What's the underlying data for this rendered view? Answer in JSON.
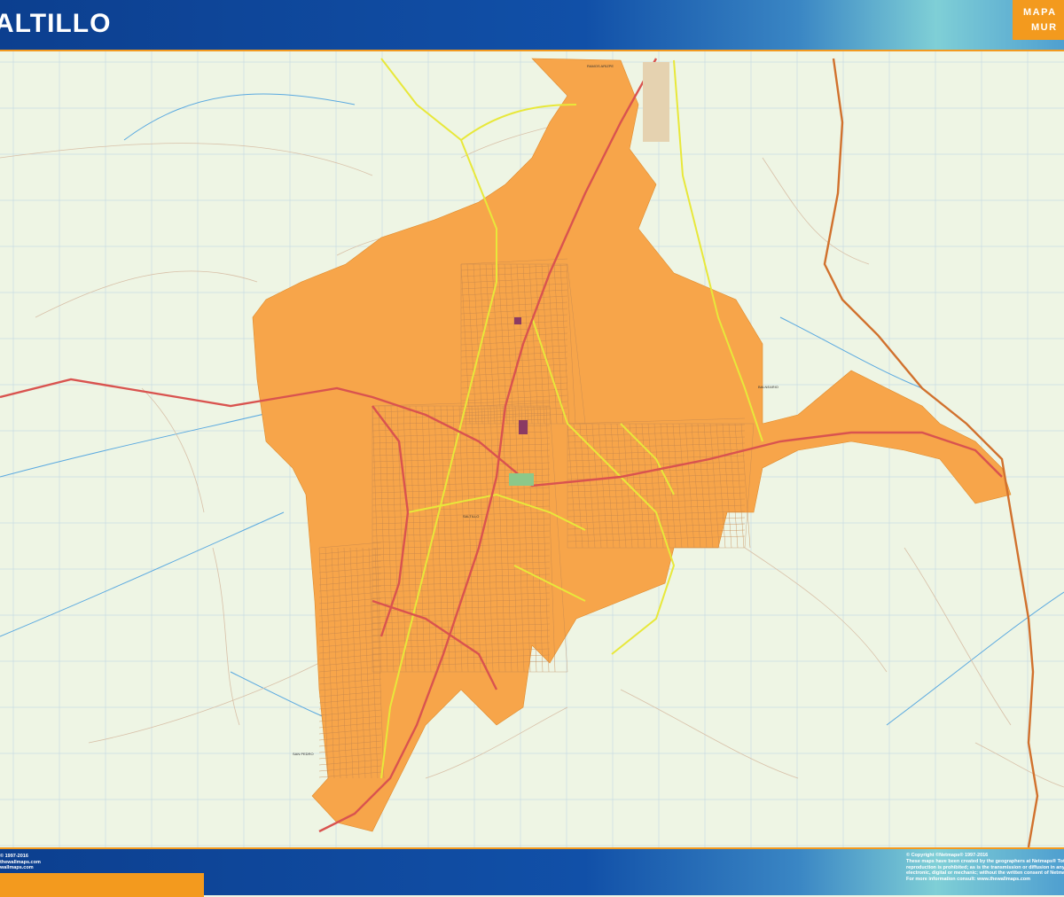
{
  "header": {
    "title": "ALTILLO"
  },
  "logo": {
    "line1": "MAPA",
    "line2": "MUR"
  },
  "map": {
    "labels": [
      "SALTILLO",
      "RAMOS ARIZPE",
      "BALNEARIO",
      "SAN PEDRO"
    ]
  },
  "footer": {
    "left": [
      "© 1997-2016",
      "thewallmaps.com",
      "wallmaps.com"
    ],
    "right": [
      "© Copyright ©Netmaps® 1997-2016",
      "These maps have been created by the geographers at Netmaps® Tota",
      "reproduction is prohibited; as is the transmission or diffusion in any",
      "electronic, digital or mechanic; without the written consent of Netma",
      "For more information consult: www.thewallmaps.com"
    ]
  },
  "colors": {
    "urban": "#f7a54a",
    "background": "#eef5e4",
    "highway": "#d9534f",
    "main_road": "#e8e83a",
    "water": "#5aa9e0",
    "accent": "#f39a1e",
    "header": "#1150a8"
  }
}
